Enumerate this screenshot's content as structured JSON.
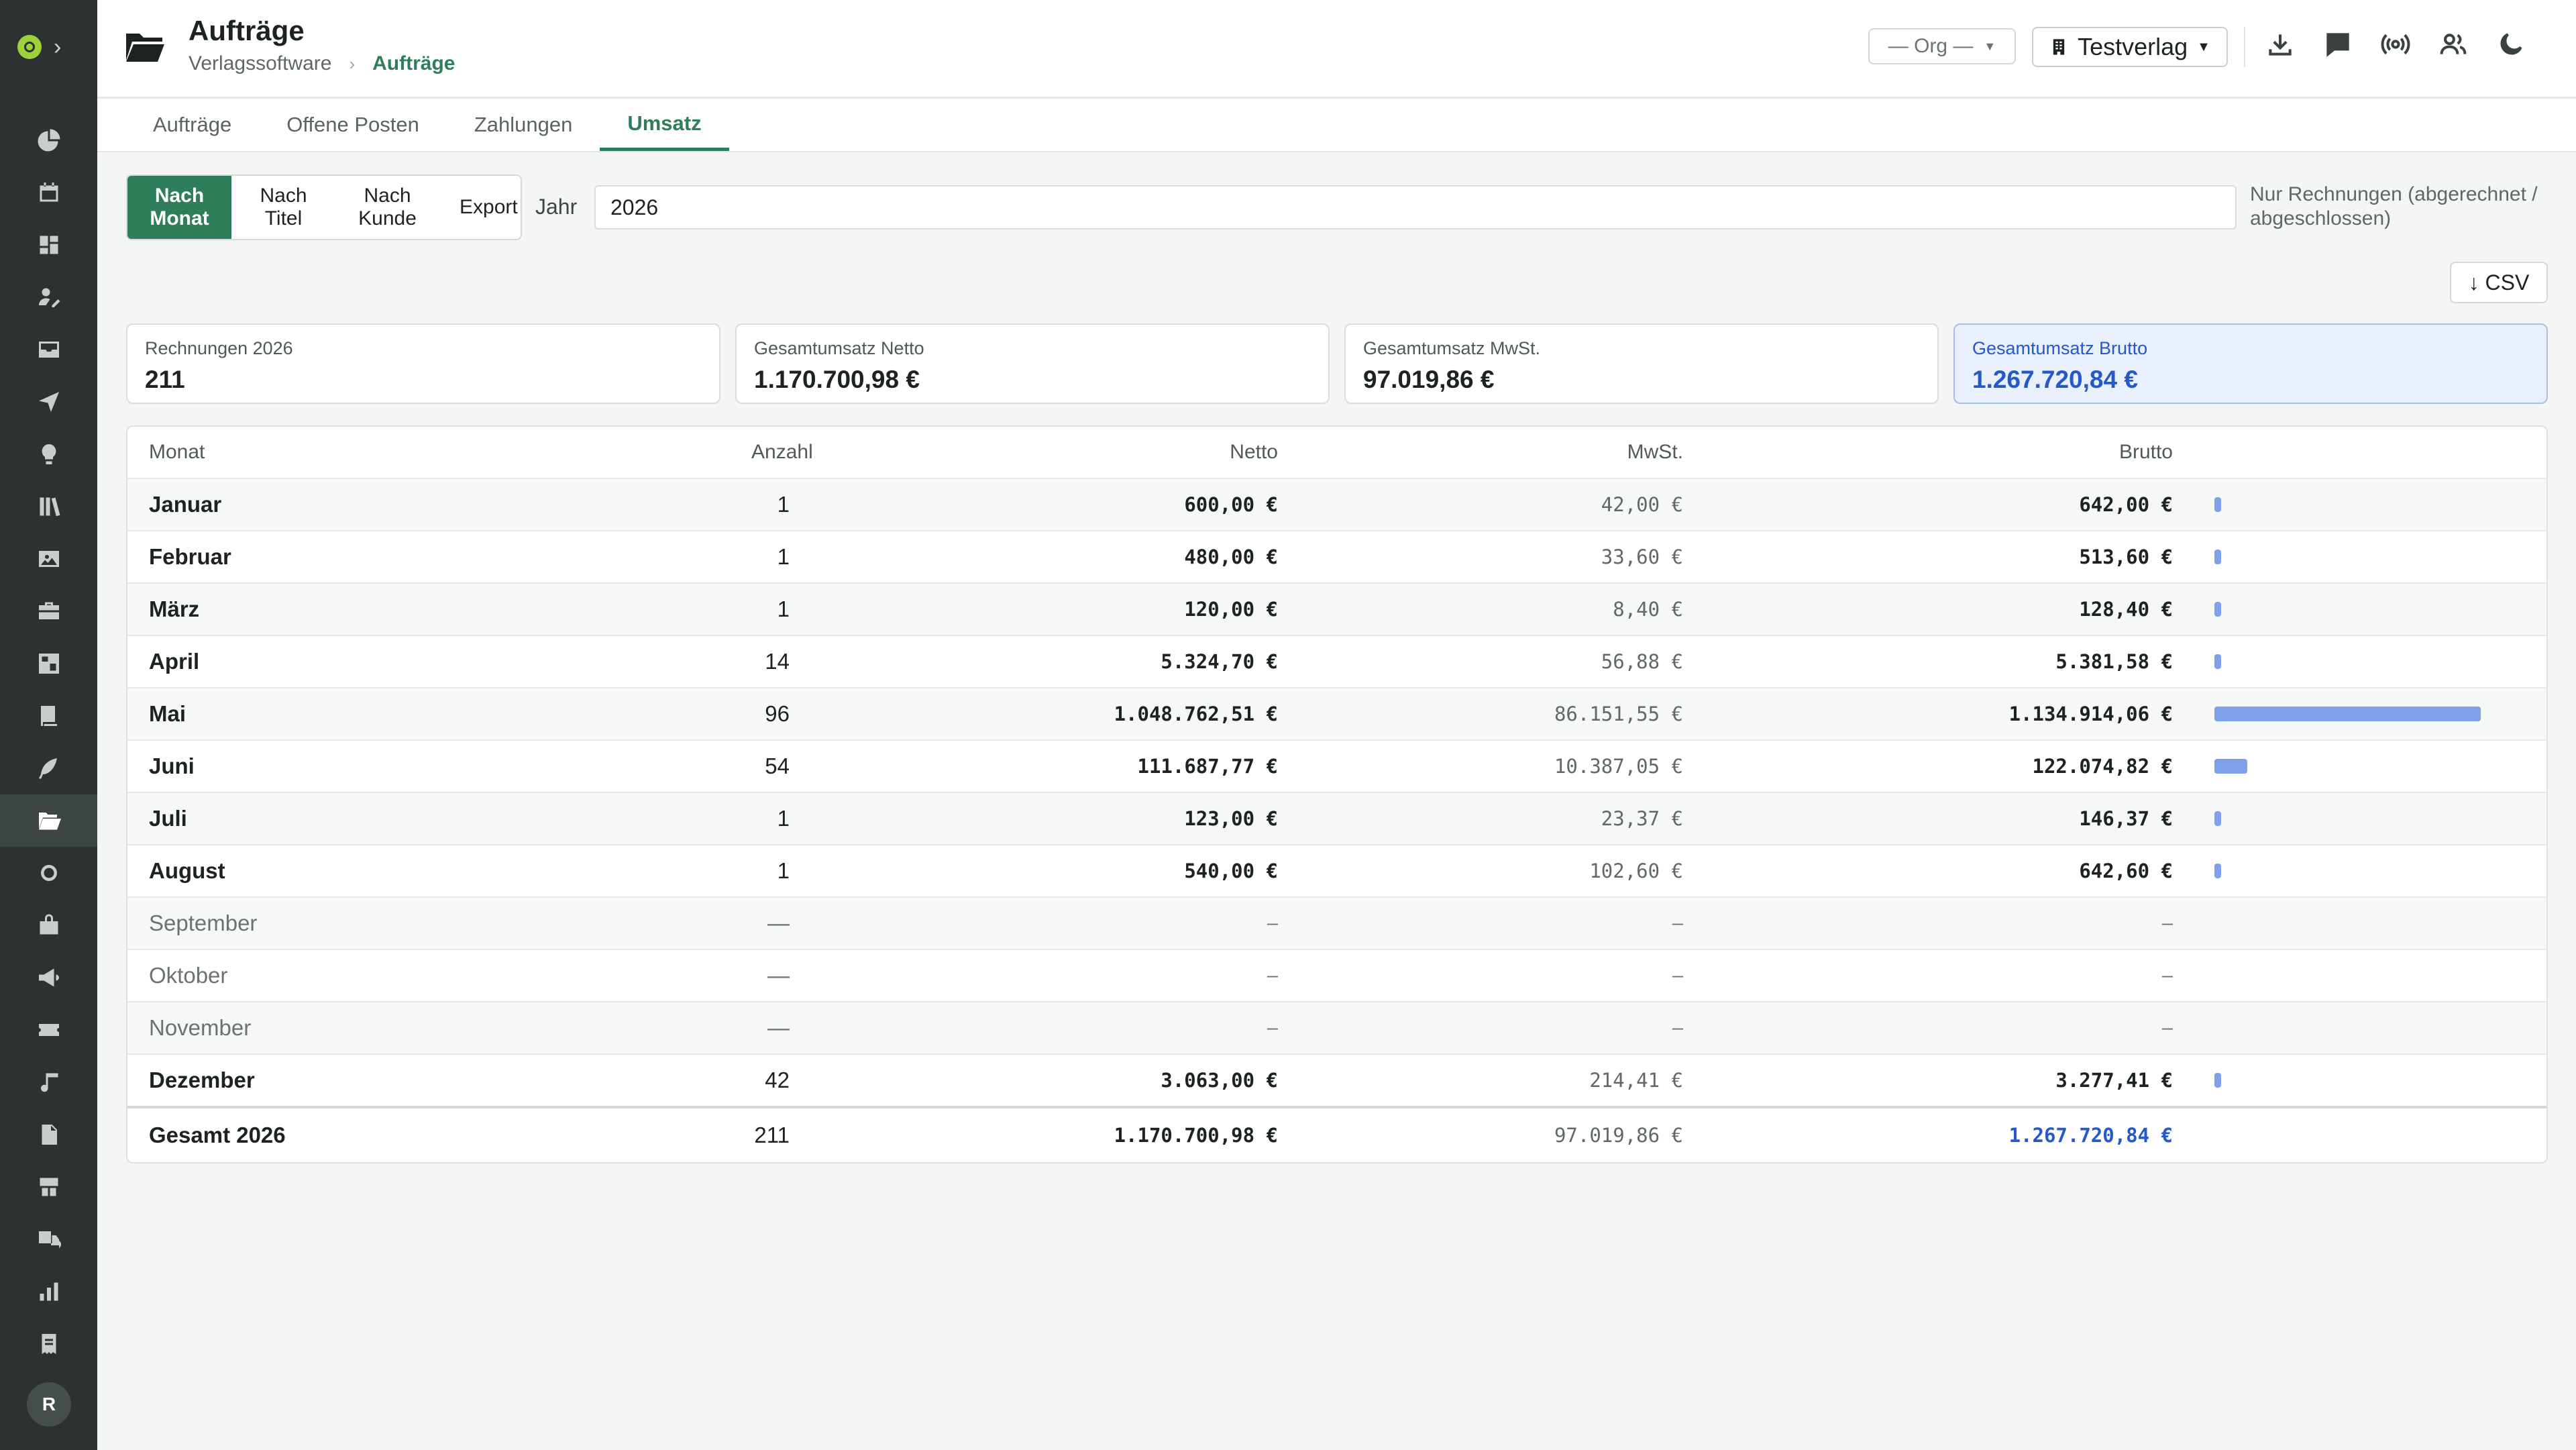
{
  "app": {
    "title": "Aufträge"
  },
  "breadcrumb": [
    "Verlagssoftware",
    "Aufträge"
  ],
  "header": {
    "org_select": "— Org —",
    "verlag_select": "Testverlag",
    "icons": [
      "download-icon",
      "chat-icon",
      "broadcast-icon",
      "users-icon",
      "moon-icon"
    ]
  },
  "sidebar": {
    "avatar": "R",
    "icons": [
      "pie-chart-icon",
      "calendar-icon",
      "dashboard-icon",
      "user-edit-icon",
      "inbox-icon",
      "send-icon",
      "lightbulb-icon",
      "library-icon",
      "image-icon",
      "briefcase-icon",
      "calendar-grid-icon",
      "book-icon",
      "feather-icon",
      "folder-open-icon",
      "circle-icon",
      "bag-icon",
      "megaphone-icon",
      "ticket-icon",
      "music-icon",
      "file-icon",
      "warehouse-icon",
      "truck-export-icon",
      "bar-chart-icon",
      "receipt-icon",
      "shield-icon"
    ],
    "active_index": 13
  },
  "tabs": [
    "Aufträge",
    "Offene Posten",
    "Zahlungen",
    "Umsatz"
  ],
  "active_tab": 3,
  "segments": [
    "Nach\nMonat",
    "Nach\nTitel",
    "Nach\nKunde",
    "Export"
  ],
  "active_segment": 0,
  "year": {
    "label": "Jahr",
    "value": "2026"
  },
  "filter_note": "Nur Rechnungen (abgerechnet / abgeschlossen)",
  "csv_button": "↓ CSV",
  "kpis": [
    {
      "label": "Rechnungen 2026",
      "value": "211"
    },
    {
      "label": "Gesamtumsatz Netto",
      "value": "1.170.700,98 €"
    },
    {
      "label": "Gesamtumsatz MwSt.",
      "value": "97.019,86 €"
    },
    {
      "label": "Gesamtumsatz Brutto",
      "value": "1.267.720,84 €"
    }
  ],
  "table": {
    "columns": [
      "Monat",
      "Anzahl",
      "Netto",
      "MwSt.",
      "Brutto"
    ],
    "rows": [
      {
        "month": "Januar",
        "count": "1",
        "netto": "600,00 €",
        "mwst": "42,00 €",
        "brutto": "642,00 €",
        "share": 0.0006
      },
      {
        "month": "Februar",
        "count": "1",
        "netto": "480,00 €",
        "mwst": "33,60 €",
        "brutto": "513,60 €",
        "share": 0.0005
      },
      {
        "month": "März",
        "count": "1",
        "netto": "120,00 €",
        "mwst": "8,40 €",
        "brutto": "128,40 €",
        "share": 0.0001
      },
      {
        "month": "April",
        "count": "14",
        "netto": "5.324,70 €",
        "mwst": "56,88 €",
        "brutto": "5.381,58 €",
        "share": 0.0047
      },
      {
        "month": "Mai",
        "count": "96",
        "netto": "1.048.762,51 €",
        "mwst": "86.151,55 €",
        "brutto": "1.134.914,06 €",
        "share": 1.0
      },
      {
        "month": "Juni",
        "count": "54",
        "netto": "111.687,77 €",
        "mwst": "10.387,05 €",
        "brutto": "122.074,82 €",
        "share": 0.1076
      },
      {
        "month": "Juli",
        "count": "1",
        "netto": "123,00 €",
        "mwst": "23,37 €",
        "brutto": "146,37 €",
        "share": 0.0001
      },
      {
        "month": "August",
        "count": "1",
        "netto": "540,00 €",
        "mwst": "102,60 €",
        "brutto": "642,60 €",
        "share": 0.0006
      },
      {
        "month": "September",
        "count": "—",
        "netto": "–",
        "mwst": "–",
        "brutto": "–",
        "share": 0
      },
      {
        "month": "Oktober",
        "count": "—",
        "netto": "–",
        "mwst": "–",
        "brutto": "–",
        "share": 0
      },
      {
        "month": "November",
        "count": "—",
        "netto": "–",
        "mwst": "–",
        "brutto": "–",
        "share": 0
      },
      {
        "month": "Dezember",
        "count": "42",
        "netto": "3.063,00 €",
        "mwst": "214,41 €",
        "brutto": "3.277,41 €",
        "share": 0.0029
      }
    ],
    "total": {
      "month": "Gesamt 2026",
      "count": "211",
      "netto": "1.170.700,98 €",
      "mwst": "97.019,86 €",
      "brutto": "1.267.720,84 €"
    }
  },
  "colors": {
    "accent": "#2e7d5b",
    "bar": "#7fa0ea",
    "highlight": "#2359c9",
    "sidebar": "#2b3231"
  }
}
